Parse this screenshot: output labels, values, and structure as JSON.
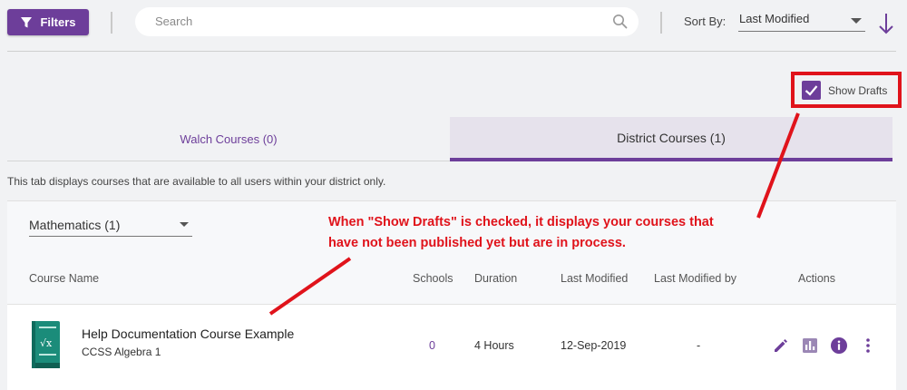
{
  "toolbar": {
    "filters_label": "Filters",
    "search_placeholder": "Search",
    "sort_by_label": "Sort By:",
    "sort_value": "Last Modified"
  },
  "drafts": {
    "label": "Show Drafts",
    "checked": true
  },
  "tabs": [
    {
      "label": "Walch Courses (0)",
      "active": false
    },
    {
      "label": "District Courses (1)",
      "active": true
    }
  ],
  "tab_description": "This tab displays courses that are available to all users within your district only.",
  "subject_filter": {
    "value": "Mathematics (1)"
  },
  "table": {
    "columns": [
      "Course Name",
      "Schools",
      "Duration",
      "Last Modified",
      "Last Modified by",
      "Actions"
    ],
    "rows": [
      {
        "title": "Help Documentation Course Example",
        "subtitle": "CCSS Algebra 1",
        "schools": "0",
        "duration": "4 Hours",
        "last_modified": "12-Sep-2019",
        "last_modified_by": "-"
      }
    ]
  },
  "annotation": {
    "line1": "When \"Show Drafts\" is checked, it displays your courses that",
    "line2": "have not been published yet but are in process."
  },
  "colors": {
    "accent": "#6d3e9a",
    "annotation": "#e0131b",
    "book": "#1b8c7a"
  }
}
